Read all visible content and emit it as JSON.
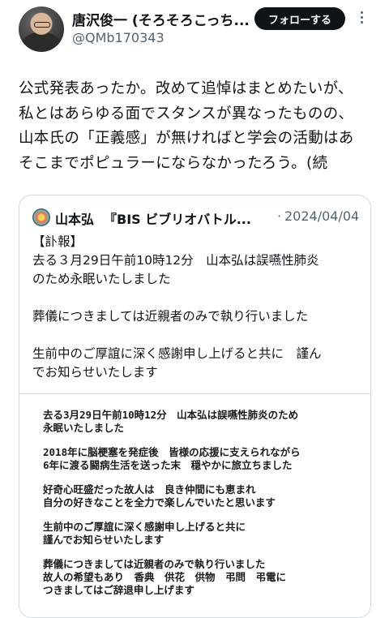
{
  "header": {
    "display_name": "唐沢俊一 (そろそろこっち...",
    "handle": "@QMb170343",
    "follow_label": "フォローする",
    "more_icon": "more-vertical-icon"
  },
  "tweet": {
    "lines": [
      "公式発表あったか。改めて追悼はまとめたいが、",
      "私とはあらゆる面でスタンスが異なったものの、",
      "山本氏の「正義感」が無ければと学会の活動はあ",
      "そこまでポピュラーにならなかったろう。(続"
    ]
  },
  "quote": {
    "name": "山本弘",
    "handle": "『BIS ビブリオバトル...",
    "dot": "·",
    "date": "2024/04/04",
    "body": [
      "【訃報】",
      "去る３月29日午前10時12分　山本弘は誤嚥性肺炎",
      "のため永眠いたしました",
      "",
      "葬儀につきましては近親者のみで執り行いました",
      "",
      "生前中のご厚誼に深く感謝申し上げると共に　謹ん",
      "でお知らせいたします"
    ],
    "image_text": [
      [
        "去る3月29日午前10時12分　山本弘は誤嚥性肺炎のため",
        "永眠いたしました"
      ],
      [
        "2018年に脳梗塞を発症後　皆様の応援に支えられながら",
        "6年に渡る闘病生活を送った末　穏やかに旅立ちました"
      ],
      [
        "好奇心旺盛だった故人は　良き仲間にも恵まれ",
        "自分の好きなことを全力で楽しんでいたと思います"
      ],
      [
        "生前中のご厚誼に深く感謝申し上げると共に",
        "謹んでお知らせいたします"
      ],
      [
        "葬儀につきましては近親者のみで執り行いました",
        "故人の希望もあり　香典　供花　供物　弔問　弔電に",
        "つきましてはご辞退申し上げます"
      ]
    ]
  }
}
